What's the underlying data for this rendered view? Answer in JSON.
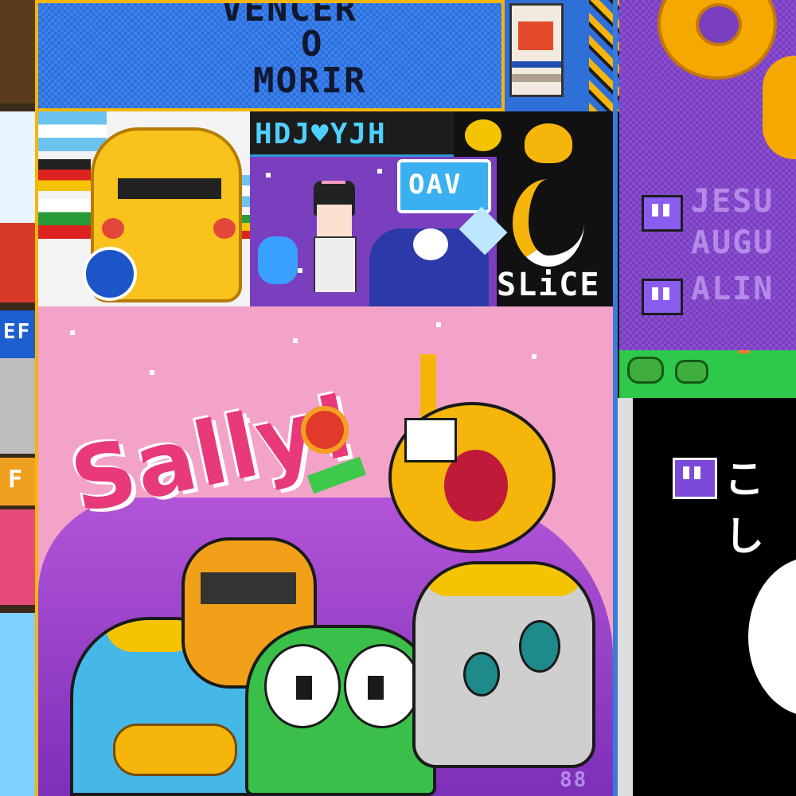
{
  "banner": {
    "line1": "VENCER",
    "line2": "O",
    "line3": "MORIR"
  },
  "streamers_box": {
    "header": "HDJ♥YJH",
    "speech_bubble": "OAV",
    "slice_label": "SLiCE"
  },
  "pink_panel": {
    "graffiti": "Sally!"
  },
  "right_purple": {
    "line1": "JESU",
    "line2": "AUGU",
    "line3": "ALIN"
  },
  "right_black": {
    "label": "こし"
  },
  "left_strip": {
    "fragment1": "EF",
    "fragment2": "F"
  },
  "footer_mark": "88",
  "colors": {
    "accent_yellow": "#f5b50a",
    "twitch_purple": "#7c4ad8",
    "pink": "#f4a3c8",
    "blue": "#2f6fd8"
  }
}
